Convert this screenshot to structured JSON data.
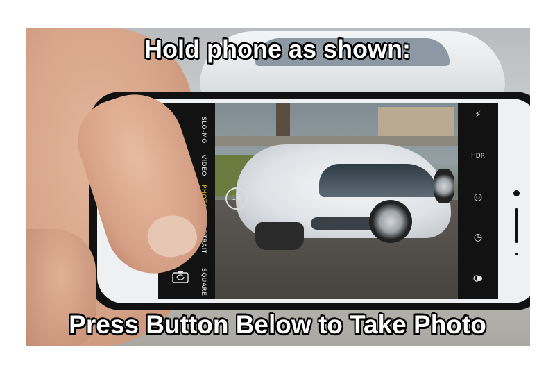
{
  "captions": {
    "top": "Hold phone as shown:",
    "bottom": "Press Button Below to Take Photo"
  },
  "camera_app": {
    "modes": [
      "SLO-MO",
      "VIDEO",
      "PHOTO",
      "PORTRAIT",
      "SQUARE"
    ],
    "active_mode": "PHOTO",
    "right_controls": {
      "flash_icon": "⚡",
      "hdr_label": "HDR",
      "live_icon": "◎",
      "timer_icon": "◷"
    },
    "zoom_label": "1×",
    "switch_camera_icon": "camera-switch-icon"
  },
  "colors": {
    "active_mode": "#f3c300",
    "caption_fill": "#ffffff",
    "caption_outline": "#000000",
    "phone_frame": "#111111"
  }
}
